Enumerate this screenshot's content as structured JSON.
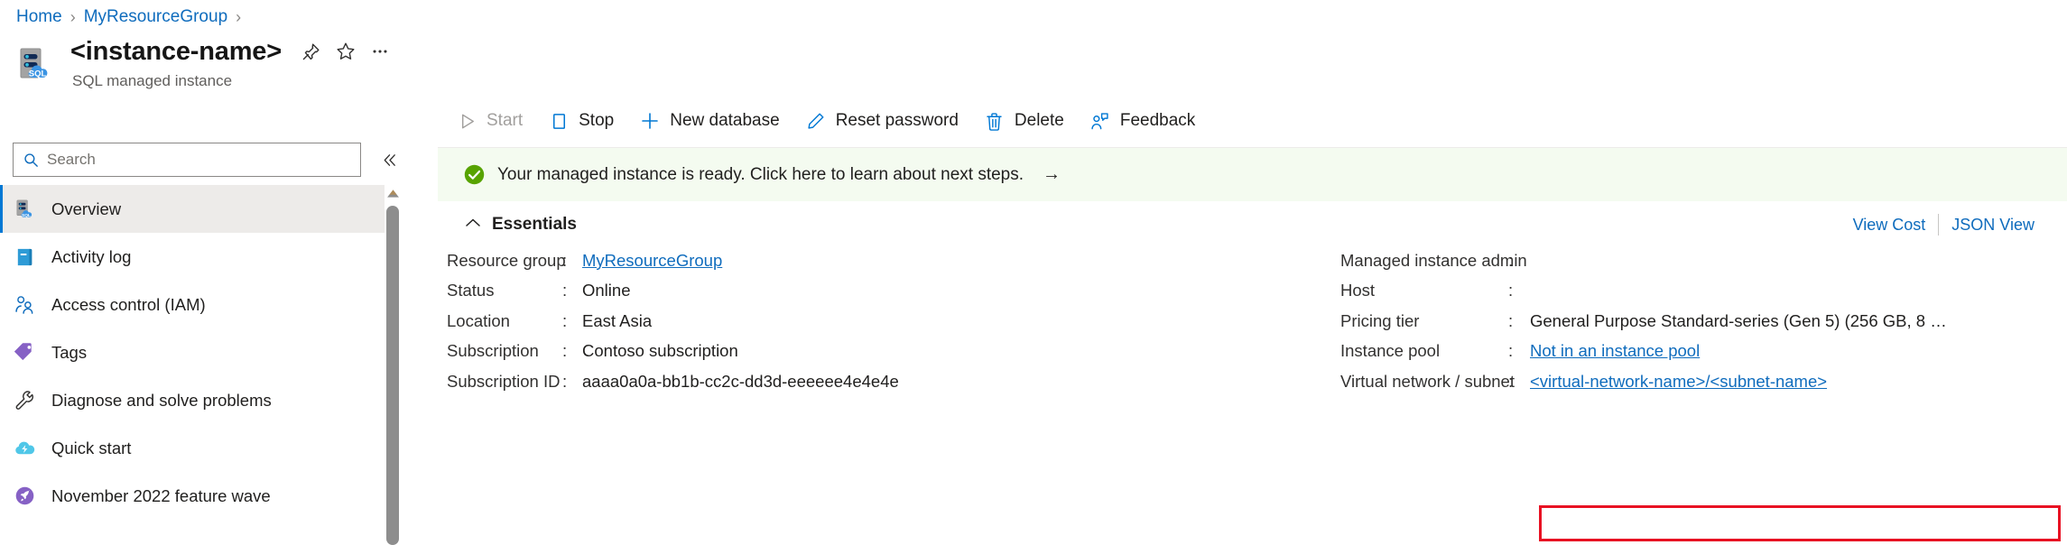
{
  "breadcrumb": {
    "items": [
      {
        "label": "Home",
        "type": "link"
      },
      {
        "label": "MyResourceGroup",
        "type": "link"
      }
    ],
    "separator": "›"
  },
  "header": {
    "title": "<instance-name>",
    "subtitle": "SQL managed instance",
    "resource_icon": "sql-managed-instance-icon",
    "actions": [
      {
        "name": "pin-icon",
        "label": "Pin"
      },
      {
        "name": "favorite-star-icon",
        "label": "Add to favorites"
      },
      {
        "name": "more-ellipsis-icon",
        "label": "More"
      }
    ]
  },
  "search": {
    "placeholder": "Search",
    "value": "",
    "icon": "search-icon"
  },
  "collapse": {
    "icon": "chevron-double-left-icon",
    "label": "«"
  },
  "sidebar": {
    "items": [
      {
        "label": "Overview",
        "icon": "sql-managed-instance-icon",
        "selected": true
      },
      {
        "label": "Activity log",
        "icon": "activity-log-icon",
        "selected": false
      },
      {
        "label": "Access control (IAM)",
        "icon": "access-control-people-icon",
        "selected": false
      },
      {
        "label": "Tags",
        "icon": "tag-icon",
        "selected": false
      },
      {
        "label": "Diagnose and solve problems",
        "icon": "wrench-icon",
        "selected": false
      },
      {
        "label": "Quick start",
        "icon": "quick-start-cloud-icon",
        "selected": false
      },
      {
        "label": "November 2022 feature wave",
        "icon": "rocket-icon",
        "selected": false
      }
    ],
    "scrollbar": {
      "up_arrow": "scroll-up-arrow"
    }
  },
  "toolbar": {
    "commands": [
      {
        "label": "Start",
        "icon": "play-triangle-icon",
        "disabled": true
      },
      {
        "label": "Stop",
        "icon": "stop-square-icon",
        "disabled": false
      },
      {
        "label": "New database",
        "icon": "plus-icon",
        "disabled": false
      },
      {
        "label": "Reset password",
        "icon": "pencil-icon",
        "disabled": false
      },
      {
        "label": "Delete",
        "icon": "trash-icon",
        "disabled": false
      },
      {
        "label": "Feedback",
        "icon": "feedback-person-icon",
        "disabled": false
      }
    ]
  },
  "notification": {
    "icon": "success-check-circle-icon",
    "text": "Your managed instance is ready. Click here to learn about next steps.",
    "arrow": "→",
    "background_color": "#f4fbf0",
    "icon_color": "#57a300"
  },
  "essentials": {
    "chevron": "∧",
    "label": "Essentials",
    "links": [
      {
        "label": "View Cost"
      },
      {
        "label": "JSON View"
      }
    ]
  },
  "properties": {
    "left": [
      {
        "label": "Resource group",
        "colon": ":",
        "value": "MyResourceGroup",
        "is_link": true
      },
      {
        "label": "Status",
        "colon": ":",
        "value": "Online",
        "is_link": false
      },
      {
        "label": "Location",
        "colon": ":",
        "value": "East Asia",
        "is_link": false
      },
      {
        "label": "Subscription",
        "colon": ":",
        "value": "Contoso subscription",
        "is_link": false
      },
      {
        "label": "Subscription ID",
        "colon": ":",
        "value": "aaaa0a0a-bb1b-cc2c-dd3d-eeeeee4e4e4e",
        "is_link": false
      }
    ],
    "right": [
      {
        "label": "Managed instance admin",
        "colon": ":",
        "value": "",
        "is_link": false
      },
      {
        "label": "Host",
        "colon": ":",
        "value": "",
        "is_link": false
      },
      {
        "label": "Pricing tier",
        "colon": ":",
        "value": "General Purpose Standard-series (Gen 5) (256 GB, 8 …",
        "is_link": false
      },
      {
        "label": "Instance pool",
        "colon": ":",
        "value": "Not in an instance pool",
        "is_link": true
      },
      {
        "label": "Virtual network / subnet",
        "colon": ":",
        "value": "<virtual-network-name>/<subnet-name>",
        "is_link": true
      }
    ]
  },
  "annotation": {
    "highlight_color": "#e81123",
    "target": "virtual-network-subnet-value"
  },
  "colors": {
    "link": "#0f6cbd",
    "accent": "#0078d4",
    "selected_nav": "#edebe9",
    "text": "#201f1e",
    "muted_text": "#605e5c"
  }
}
